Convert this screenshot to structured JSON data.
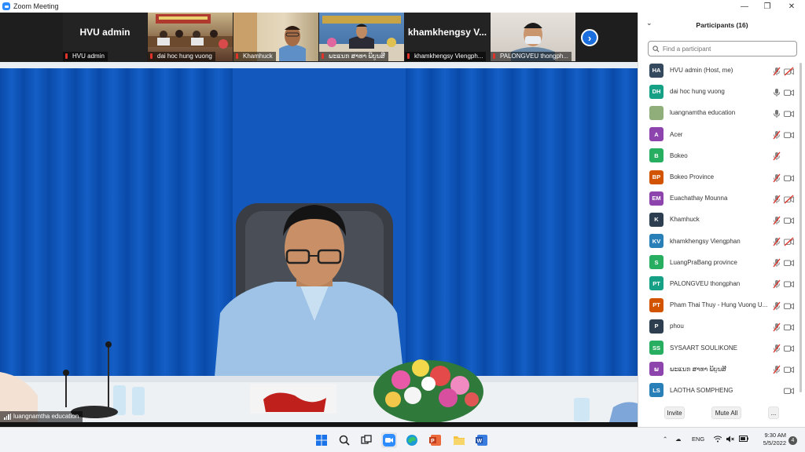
{
  "window": {
    "title": "Zoom Meeting"
  },
  "video_strip": {
    "tiles": [
      {
        "name": "HVU admin",
        "big_label": "HVU admin"
      },
      {
        "name": "dai hoc hung vuong"
      },
      {
        "name": "Khamhuck"
      },
      {
        "name": "ພະແນກ ສາທາ ພິບູນສີ"
      },
      {
        "name": "khamkhengsy Viengph...",
        "big_label": "khamkhengsy  V..."
      },
      {
        "name": "PALONGVEU thongph..."
      }
    ]
  },
  "main_video": {
    "speaker_name": "luangnamtha education"
  },
  "panel": {
    "title": "Participants (16)",
    "search_placeholder": "Find a participant",
    "participants": [
      {
        "initials": "HA",
        "name": "HVU admin (Host, me)",
        "color": "#34495e",
        "mic": "muted",
        "video": "off"
      },
      {
        "initials": "DH",
        "name": "dai hoc hung vuong",
        "color": "#16a085",
        "mic": "on",
        "video": "on"
      },
      {
        "initials": "",
        "name": "luangnamtha education",
        "color": "#8fae7a",
        "mic": "on",
        "video": "on"
      },
      {
        "initials": "A",
        "name": "Acer",
        "color": "#8e44ad",
        "mic": "muted",
        "video": "on"
      },
      {
        "initials": "B",
        "name": "Bokeo",
        "color": "#27ae60",
        "mic": "muted",
        "video": "none"
      },
      {
        "initials": "BP",
        "name": "Bokeo Province",
        "color": "#d35400",
        "mic": "muted",
        "video": "on"
      },
      {
        "initials": "EM",
        "name": "Euachathay Mounna",
        "color": "#8e44ad",
        "mic": "muted",
        "video": "off"
      },
      {
        "initials": "K",
        "name": "Khamhuck",
        "color": "#2c3e50",
        "mic": "muted",
        "video": "on"
      },
      {
        "initials": "KV",
        "name": "khamkhengsy Viengphan",
        "color": "#2980b9",
        "mic": "muted",
        "video": "off"
      },
      {
        "initials": "S",
        "name": "LuangPraBang province",
        "color": "#27ae60",
        "mic": "muted",
        "video": "on"
      },
      {
        "initials": "PT",
        "name": "PALONGVEU thongphan",
        "color": "#16a085",
        "mic": "muted",
        "video": "on"
      },
      {
        "initials": "PT",
        "name": "Pham Thai Thuy - Hung Vuong U...",
        "color": "#d35400",
        "mic": "muted",
        "video": "on"
      },
      {
        "initials": "P",
        "name": "phou",
        "color": "#2c3e50",
        "mic": "muted",
        "video": "on"
      },
      {
        "initials": "SS",
        "name": "SYSAART SOULIKONE",
        "color": "#27ae60",
        "mic": "muted",
        "video": "on"
      },
      {
        "initials": "ພ",
        "name": "ພະແນກ ສາທາ ພິບູນສີ",
        "color": "#8e44ad",
        "mic": "muted",
        "video": "on"
      },
      {
        "initials": "LS",
        "name": "LAOTHA SOMPHENG",
        "color": "#2980b9",
        "mic": "none",
        "video": "on"
      }
    ],
    "footer": {
      "invite": "Invite",
      "mute_all": "Mute All",
      "more": "..."
    }
  },
  "taskbar": {
    "tray": {
      "language": "ENG"
    },
    "clock": {
      "time": "9:30 AM",
      "date": "5/5/2022"
    },
    "notification_count": "4"
  },
  "colors": {
    "zoom_blue": "#2d8cff",
    "curtain_blue": "#0d4fb0",
    "muted_red": "#e0342b"
  }
}
